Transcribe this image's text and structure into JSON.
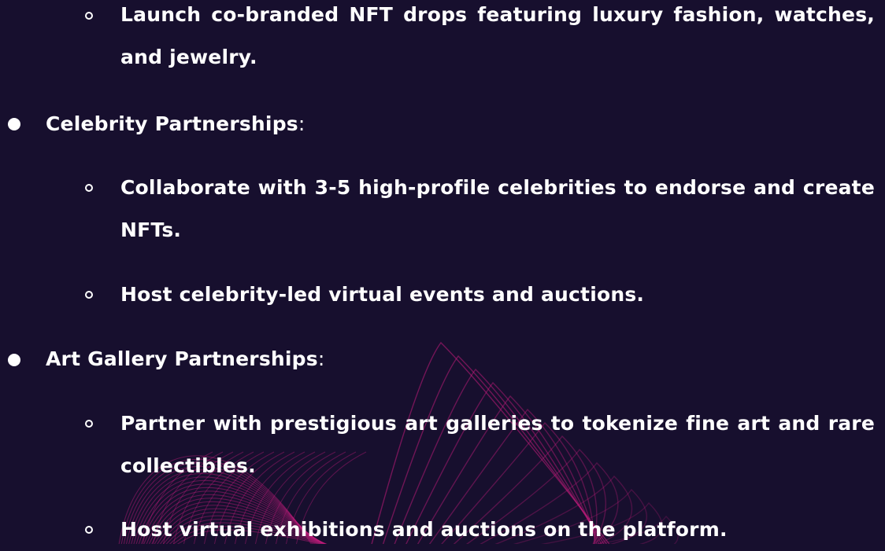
{
  "items": [
    {
      "level": 2,
      "text": "Launch co-branded NFT drops featuring luxury fashion, watches, and jewelry."
    },
    {
      "level": 1,
      "text": "Celebrity Partnerships",
      "suffix": ":"
    },
    {
      "level": 2,
      "text": "Collaborate with 3-5 high-profile celebrities to endorse and create NFTs."
    },
    {
      "level": 2,
      "text": "Host celebrity-led virtual events and auctions."
    },
    {
      "level": 1,
      "text": "Art Gallery Partnerships",
      "suffix": ":"
    },
    {
      "level": 2,
      "text": "Partner with prestigious art galleries to tokenize fine art and rare collectibles."
    },
    {
      "level": 2,
      "text": "Host virtual exhibitions and auctions on the platform."
    }
  ],
  "colors": {
    "background": "#170f2e",
    "text": "#ffffff",
    "decoration": "#c21c7c"
  }
}
